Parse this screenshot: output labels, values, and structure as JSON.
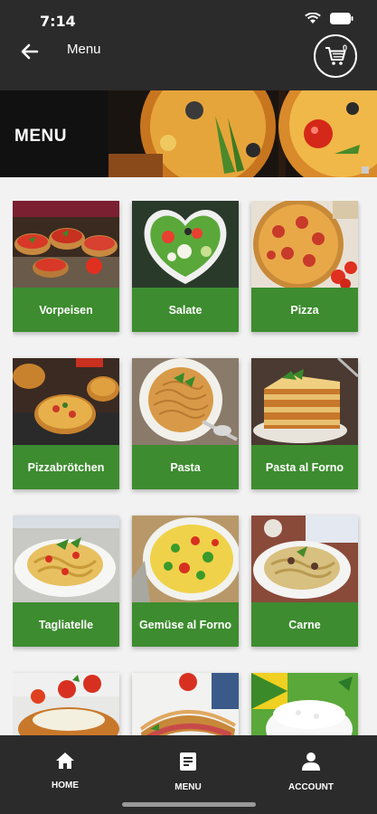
{
  "status_bar": {
    "time": "7:14"
  },
  "header": {
    "title": "Menu",
    "cart_count": "0"
  },
  "banner": {
    "title": "MENU"
  },
  "categories": [
    {
      "label": "Vorpeisen"
    },
    {
      "label": "Salate"
    },
    {
      "label": "Pizza"
    },
    {
      "label": "Pizzabrötchen"
    },
    {
      "label": "Pasta"
    },
    {
      "label": "Pasta al Forno"
    },
    {
      "label": "Tagliatelle"
    },
    {
      "label": "Gemüse al Forno"
    },
    {
      "label": "Carne"
    },
    {
      "label": ""
    },
    {
      "label": ""
    },
    {
      "label": ""
    }
  ],
  "bottom_nav": {
    "home": "HOME",
    "menu": "MENU",
    "account": "ACCOUNT"
  },
  "colors": {
    "header_bg": "#2b2b2b",
    "accent_green": "#3d8c2f",
    "page_bg": "#f2f2f2"
  }
}
